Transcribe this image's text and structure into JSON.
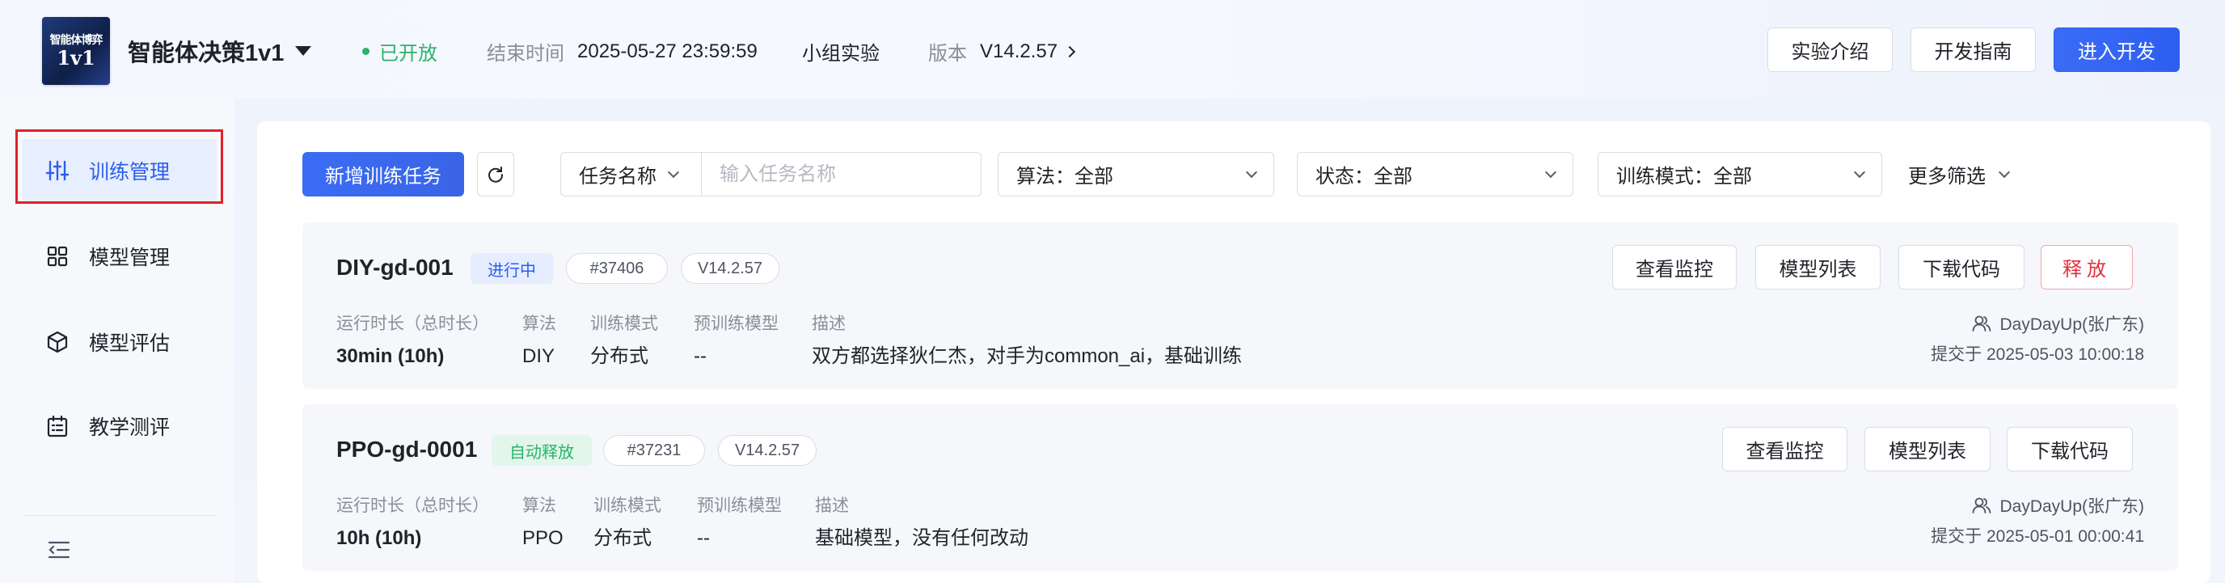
{
  "header": {
    "logo_text_top": "智能体博弈",
    "logo_text_bottom": "1v1",
    "title": "智能体决策1v1",
    "status": "已开放",
    "end_time_label": "结束时间",
    "end_time": "2025-05-27 23:59:59",
    "group": "小组实验",
    "version_label": "版本",
    "version": "V14.2.57",
    "buttons": {
      "intro": "实验介绍",
      "guide": "开发指南",
      "enter": "进入开发"
    },
    "colors": {
      "primary": "#2d5ef0",
      "open": "#29b36b"
    }
  },
  "sidebar": {
    "items": [
      {
        "label": "训练管理",
        "icon": "sliders-icon",
        "active": true
      },
      {
        "label": "模型管理",
        "icon": "grid-icon",
        "active": false
      },
      {
        "label": "模型评估",
        "icon": "cube-icon",
        "active": false
      },
      {
        "label": "教学测评",
        "icon": "calendar-list-icon",
        "active": false
      }
    ],
    "collapse_icon": "menu-collapse-icon"
  },
  "toolbar": {
    "add_task": "新增训练任务",
    "search_field": "任务名称",
    "search_placeholder": "输入任务名称",
    "filters": {
      "algorithm": "算法：全部",
      "status": "状态：全部",
      "mode": "训练模式：全部"
    },
    "more_filters": "更多筛选"
  },
  "labels": {
    "runtime": "运行时长（总时长）",
    "algorithm": "算法",
    "mode": "训练模式",
    "pretrained": "预训练模型",
    "description": "描述",
    "submitted_prefix": "提交于",
    "btn_monitor": "查看监控",
    "btn_models": "模型列表",
    "btn_download": "下载代码",
    "btn_release": "释放"
  },
  "tasks": [
    {
      "name": "DIY-gd-001",
      "state": "进行中",
      "id": "#37406",
      "version": "V14.2.57",
      "runtime": "30min (10h)",
      "algorithm": "DIY",
      "mode": "分布式",
      "pretrained": "--",
      "description": "双方都选择狄仁杰，对手为common_ai，基础训练",
      "owner": "DayDayUp(张广东)",
      "submitted": "2025-05-03 10:00:18"
    },
    {
      "name": "PPO-gd-0001",
      "state": "自动释放",
      "id": "#37231",
      "version": "V14.2.57",
      "runtime": "10h (10h)",
      "algorithm": "PPO",
      "mode": "分布式",
      "pretrained": "--",
      "description": "基础模型，没有任何改动",
      "owner": "DayDayUp(张广东)",
      "submitted": "2025-05-01 00:00:41"
    }
  ]
}
